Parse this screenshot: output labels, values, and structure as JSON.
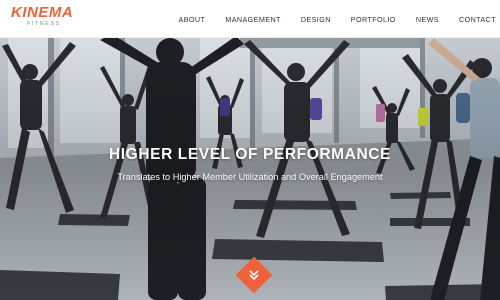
{
  "brand": {
    "name": "KINEMA",
    "tagline": "FITNESS",
    "accent": "#f0603a"
  },
  "nav": {
    "items": [
      {
        "label": "ABOUT"
      },
      {
        "label": "MANAGEMENT"
      },
      {
        "label": "DESIGN"
      },
      {
        "label": "PORTFOLIO"
      },
      {
        "label": "NEWS"
      },
      {
        "label": "CONTACT"
      }
    ]
  },
  "hero": {
    "title": "HIGHER LEVEL OF PERFORMANCE",
    "subtitle": "Translates to Higher Member Utilization and Overall Engagement",
    "scroll_icon": "chevron-down-icon"
  }
}
